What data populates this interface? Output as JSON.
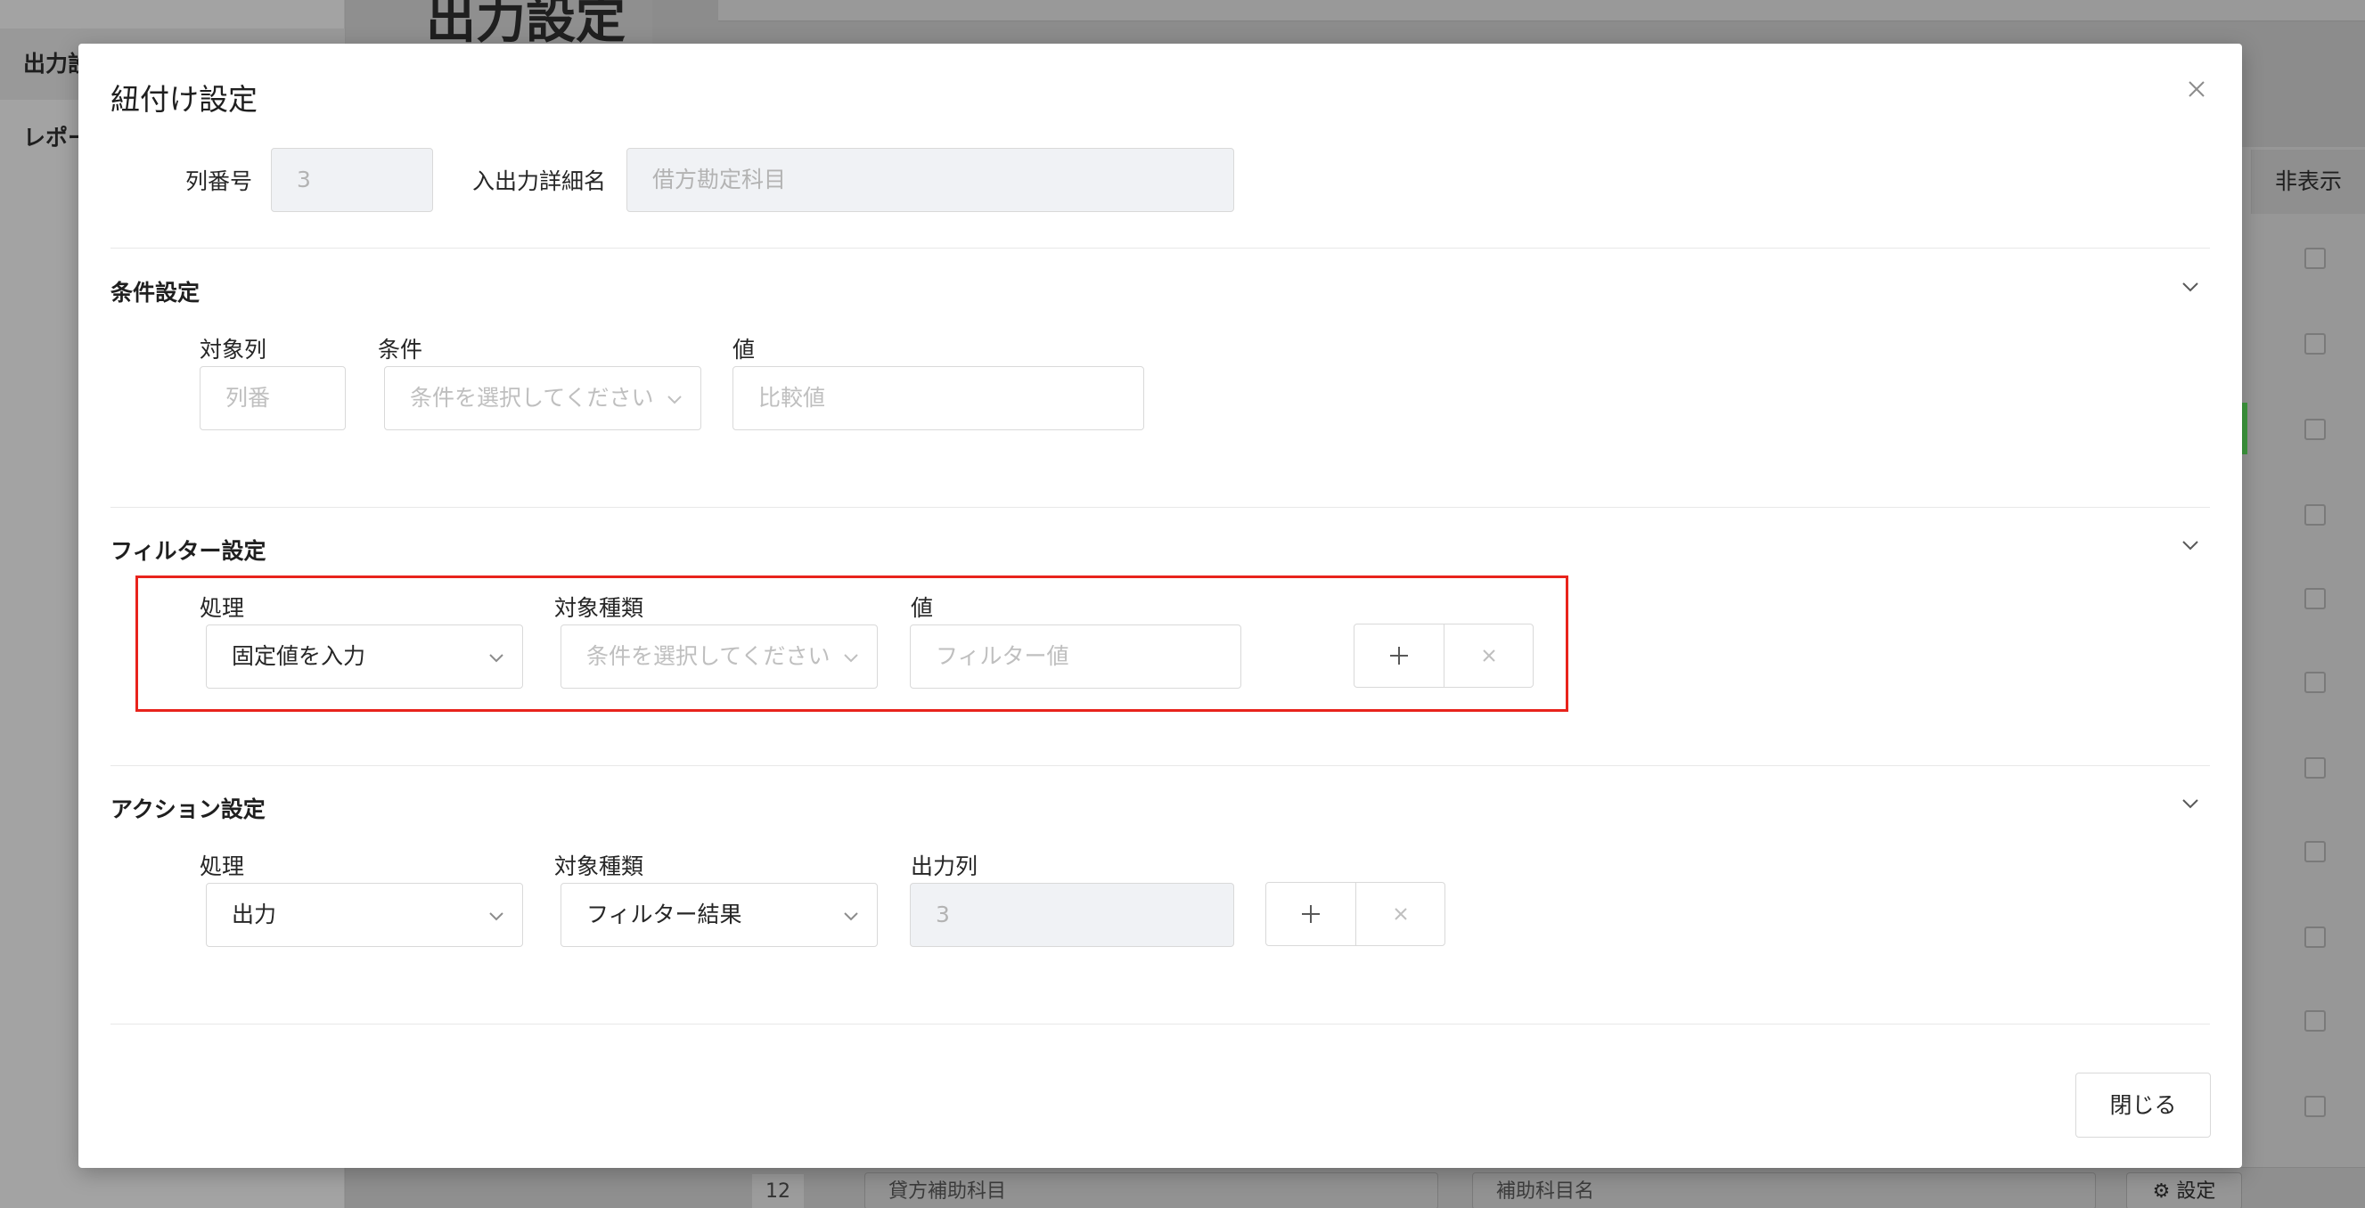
{
  "background": {
    "page_title": "出力設定",
    "sidebar": {
      "items": [
        {
          "label": "出力設"
        },
        {
          "label": "レポー"
        }
      ]
    },
    "table": {
      "hidden_column_header": "非表示",
      "last_row": {
        "number": "12",
        "field1": "貸方補助科目",
        "field2": "補助科目名",
        "settings_button": "設定"
      }
    }
  },
  "modal": {
    "title": "紐付け設定",
    "column_number": {
      "label": "列番号",
      "value": "3"
    },
    "io_detail_name": {
      "label": "入出力詳細名",
      "placeholder": "借方勘定科目"
    },
    "condition": {
      "title": "条件設定",
      "target_column": {
        "label": "対象列",
        "placeholder": "列番"
      },
      "condition": {
        "label": "条件",
        "placeholder": "条件を選択してください"
      },
      "value": {
        "label": "値",
        "placeholder": "比較値"
      }
    },
    "filter": {
      "title": "フィルター設定",
      "process": {
        "label": "処理",
        "value": "固定値を入力"
      },
      "target_type": {
        "label": "対象種類",
        "placeholder": "条件を選択してください"
      },
      "value": {
        "label": "値",
        "placeholder": "フィルター値"
      }
    },
    "action": {
      "title": "アクション設定",
      "process": {
        "label": "処理",
        "value": "出力"
      },
      "target_type": {
        "label": "対象種類",
        "value": "フィルター結果"
      },
      "output_column": {
        "label": "出力列",
        "value": "3"
      }
    },
    "close_button": "閉じる"
  },
  "colors": {
    "highlight": "#e8231c",
    "disabled_bg": "#f0f2f5",
    "border": "#d9d9d9"
  }
}
